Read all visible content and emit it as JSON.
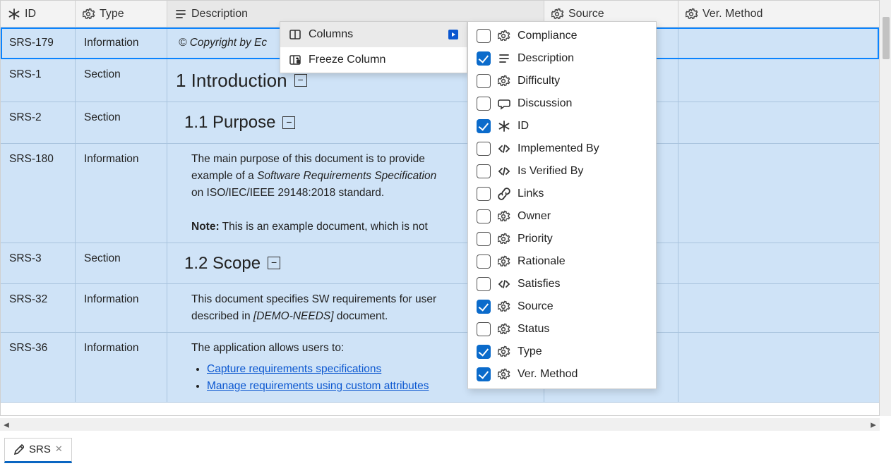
{
  "columns": {
    "id": "ID",
    "type": "Type",
    "description": "Description",
    "source": "Source",
    "ver_method": "Ver. Method"
  },
  "rows": [
    {
      "id": "SRS-179",
      "type": "Information",
      "desc_kind": "copyright",
      "copyright": "© Copyright by Ec"
    },
    {
      "id": "SRS-1",
      "type": "Section",
      "desc_kind": "h1",
      "heading": "1 Introduction"
    },
    {
      "id": "SRS-2",
      "type": "Section",
      "desc_kind": "h2",
      "heading": "1.1 Purpose"
    },
    {
      "id": "SRS-180",
      "type": "Information",
      "desc_kind": "purpose",
      "p1a": "The main purpose of this document is to provide ",
      "p1b": "example of a ",
      "em": "Software Requirements Specification",
      "p1c": " on ISO/IEC/IEEE 29148:2018 standard.",
      "note_lbl": "Note:",
      "note": " This is an example document, which is not "
    },
    {
      "id": "SRS-3",
      "type": "Section",
      "desc_kind": "h2",
      "heading": "1.2 Scope"
    },
    {
      "id": "SRS-32",
      "type": "Information",
      "desc_kind": "scope",
      "p1a": "This document specifies SW requirements for user",
      "p1b": "described  in ",
      "em": "[DEMO-NEEDS]",
      "p1c": " document."
    },
    {
      "id": "SRS-36",
      "type": "Information",
      "desc_kind": "allows",
      "lead": "The application allows users to:",
      "items": [
        "Capture requirements specifications",
        "Manage requirements using custom attributes"
      ]
    }
  ],
  "ctx_menu": {
    "columns": "Columns",
    "freeze": "Freeze Column"
  },
  "column_picker": [
    {
      "label": "Compliance",
      "icon": "gear",
      "checked": false
    },
    {
      "label": "Description",
      "icon": "align",
      "checked": true
    },
    {
      "label": "Difficulty",
      "icon": "gear",
      "checked": false
    },
    {
      "label": "Discussion",
      "icon": "chat",
      "checked": false
    },
    {
      "label": "ID",
      "icon": "asterisk",
      "checked": true
    },
    {
      "label": "Implemented By",
      "icon": "code",
      "checked": false
    },
    {
      "label": "Is Verified By",
      "icon": "code",
      "checked": false
    },
    {
      "label": "Links",
      "icon": "link",
      "checked": false
    },
    {
      "label": "Owner",
      "icon": "gear",
      "checked": false
    },
    {
      "label": "Priority",
      "icon": "gear",
      "checked": false
    },
    {
      "label": "Rationale",
      "icon": "gear",
      "checked": false
    },
    {
      "label": "Satisfies",
      "icon": "code",
      "checked": false
    },
    {
      "label": "Source",
      "icon": "gear",
      "checked": true
    },
    {
      "label": "Status",
      "icon": "gear",
      "checked": false
    },
    {
      "label": "Type",
      "icon": "gear",
      "checked": true
    },
    {
      "label": "Ver. Method",
      "icon": "gear",
      "checked": true
    }
  ],
  "tab": {
    "label": "SRS"
  }
}
